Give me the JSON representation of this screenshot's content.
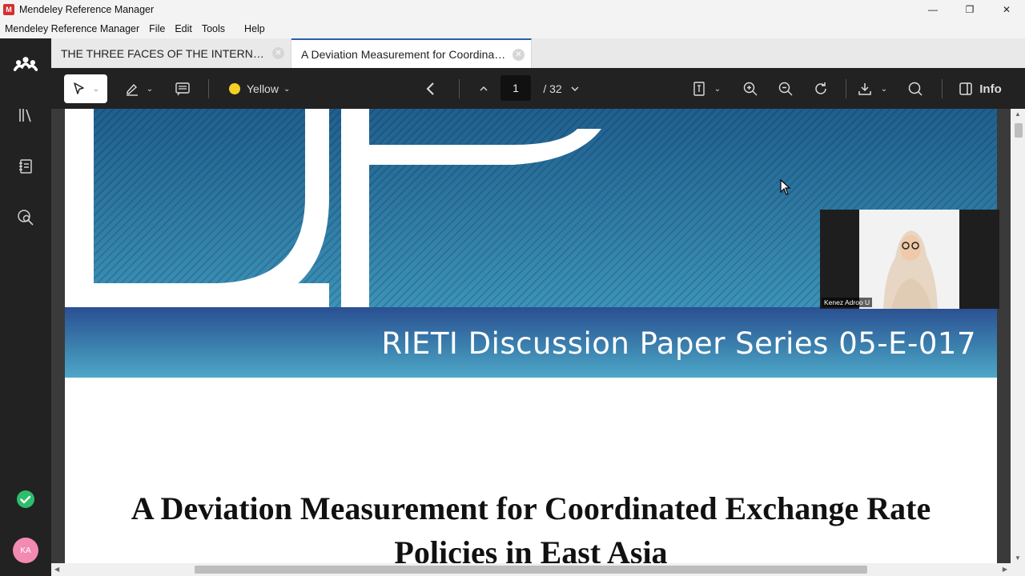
{
  "window": {
    "title": "Mendeley Reference Manager",
    "minimize": "—",
    "maximize": "❐",
    "close": "✕"
  },
  "menubar": {
    "items": [
      "Mendeley Reference Manager",
      "File",
      "Edit",
      "Tools",
      "Help"
    ]
  },
  "rail": {
    "icons": [
      "mendeley-logo-icon",
      "library-icon",
      "notebook-icon",
      "search-literature-icon",
      "sync-status-icon"
    ],
    "avatar_initials": "KA",
    "sync_color": "#2ebd6b",
    "avatar_color": "#f28ab2"
  },
  "tabs": [
    {
      "label": "THE THREE FACES OF THE INTERNATIONAL COMPARISON",
      "active": false
    },
    {
      "label": "A Deviation Measurement for Coordinated Exchange Rate Policies",
      "active": true
    }
  ],
  "toolbar": {
    "highlight_color_label": "Yellow",
    "highlight_color": "#f2d024",
    "page_current": "1",
    "page_separator": "/",
    "page_total": "32",
    "info_label": "Info"
  },
  "document": {
    "series_banner": "RIETI Discussion Paper Series 05-E-017",
    "title_line1": "A Deviation Measurement for Coordinated Exchange Rate",
    "title_line2": "Policies in East Asia"
  },
  "video": {
    "participant_name": "Kenez Adroo U"
  }
}
